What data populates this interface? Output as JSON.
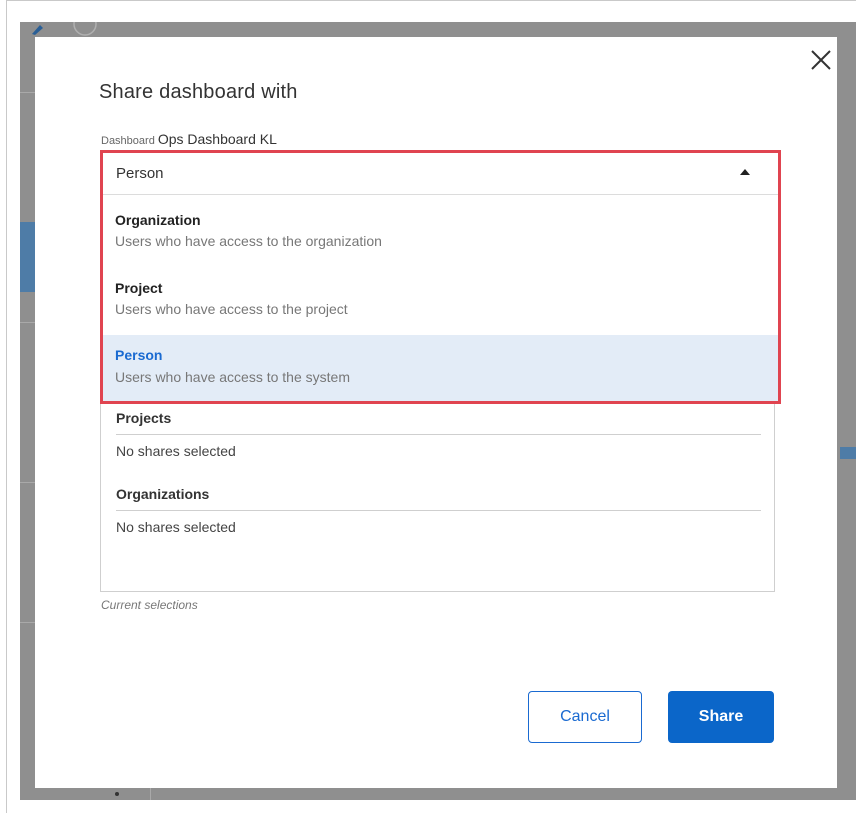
{
  "modal": {
    "title": "Share dashboard with",
    "dashboard_label": "Dashboard",
    "dashboard_name": "Ops Dashboard KL"
  },
  "share_type": {
    "selected": "Person",
    "options": [
      {
        "title": "Organization",
        "description": "Users who have access to the organization"
      },
      {
        "title": "Project",
        "description": "Users who have access to the project"
      },
      {
        "title": "Person",
        "description": "Users who have access to the system"
      }
    ]
  },
  "selections": {
    "projects_heading": "Projects",
    "projects_empty": "No shares selected",
    "organizations_heading": "Organizations",
    "organizations_empty": "No shares selected",
    "helper": "Current selections"
  },
  "buttons": {
    "cancel": "Cancel",
    "share": "Share"
  },
  "icons": {
    "close": "close-icon",
    "caret": "caret-up-icon"
  },
  "colors": {
    "accent": "#0b66c9",
    "highlight_border": "#e04450",
    "selected_option_bg": "#e3ecf7"
  }
}
